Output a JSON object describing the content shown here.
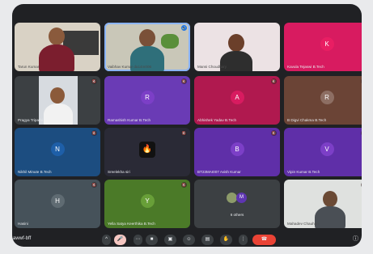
{
  "tiles": [
    {
      "name": "Tarun Kumar"
    },
    {
      "name": "Vaibhav Kumar da14m006"
    },
    {
      "name": "Mansi Choudhary"
    },
    {
      "name": "Kavula Tejaswi B.Tech",
      "initial": "K"
    },
    {
      "name": "Pragya Tripathi"
    },
    {
      "name": "Ramashish Kumar B.Tech",
      "initial": "R"
    },
    {
      "name": "Abhishek Yadav B.Tech",
      "initial": "A"
    },
    {
      "name": "B Digvi Chakma B.Tech",
      "initial": "R"
    },
    {
      "name": "Nikhil Minute B.Tech",
      "initial": "N"
    },
    {
      "name": "Sreelekha siri"
    },
    {
      "name": "BT23MAI007 Avish Kumar",
      "initial": "B"
    },
    {
      "name": "Vipin Kumar B.Tech",
      "initial": "V"
    },
    {
      "name": "Hasini",
      "initial": "H"
    },
    {
      "name": "Yella Satya Keerthika B.Tech",
      "initial": "Y"
    },
    {
      "name": "6 others",
      "initial": "M"
    },
    {
      "name": "Mahadev Chauhan"
    }
  ],
  "meeting": {
    "code": "awwf-bff"
  },
  "icons": {
    "mute": "🔇",
    "speaking": "🔊",
    "fire": "🔥",
    "chevron": "^",
    "mic_off": "🎤",
    "more_options": "⋯",
    "camera": "■",
    "present": "▣",
    "emoji": "☺",
    "captions": "▤",
    "hand": "✋",
    "more": "⋮",
    "hangup": "☎",
    "info": "ⓘ"
  },
  "colors": {
    "purple": "#7c3fc7",
    "pink": "#d81b60",
    "brown": "#795548",
    "blue": "#1e5fa8",
    "green": "#558b2f",
    "gray": "#4f5b62",
    "red": "#ea4335"
  }
}
